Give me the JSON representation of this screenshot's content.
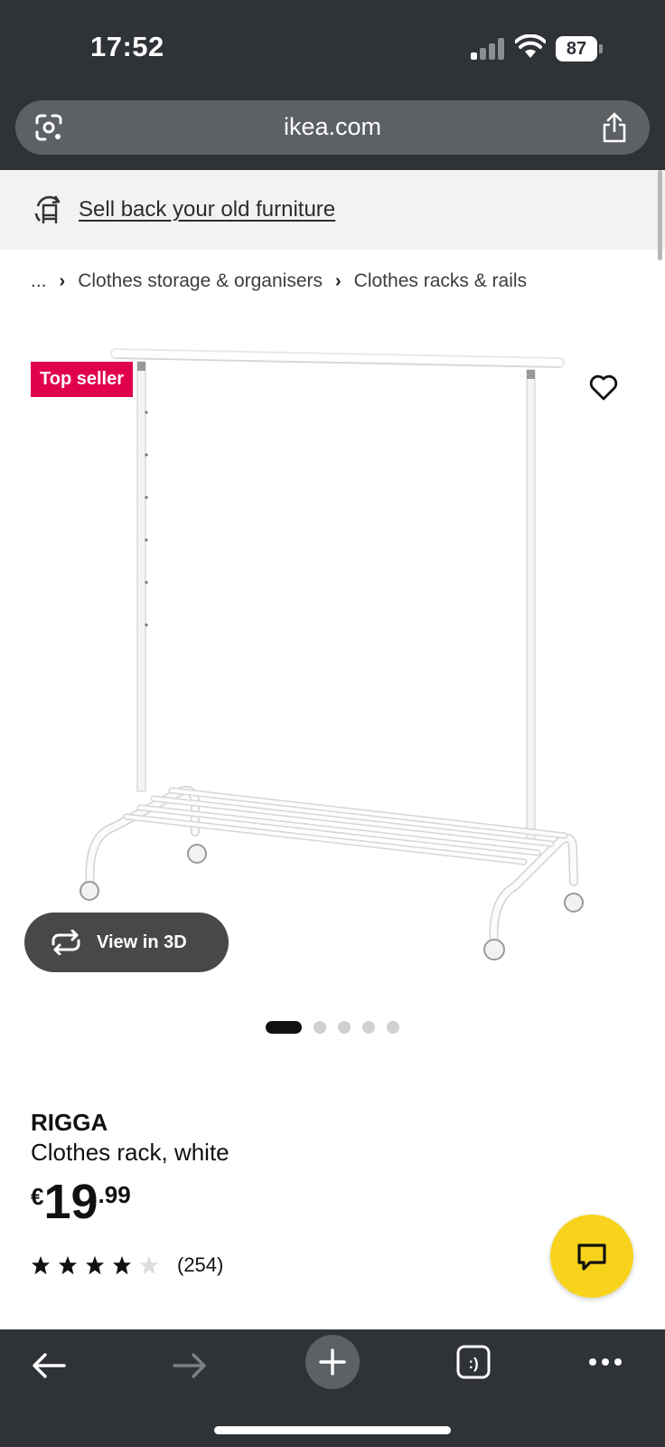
{
  "status_bar": {
    "time": "17:52",
    "battery": "87",
    "signal_bars_active": 1
  },
  "browser": {
    "url": "ikea.com",
    "icons": [
      "google-lens-icon",
      "share-icon"
    ]
  },
  "banner": {
    "icon": "buyback-recycle-icon",
    "link_text": "Sell back your old furniture"
  },
  "breadcrumb": {
    "items": [
      "...",
      "Clothes storage & organisers",
      "Clothes racks & rails"
    ]
  },
  "gallery": {
    "badge": "Top seller",
    "favorite_icon": "heart-icon",
    "view3d_label": "View in 3D",
    "image_count": 5,
    "active_index": 0
  },
  "product": {
    "name": "RIGGA",
    "description": "Clothes rack, white",
    "price_currency": "€",
    "price_integer": "19",
    "price_decimal": ".99",
    "rating_stars": 4,
    "rating_max": 5,
    "review_count": "(254)"
  },
  "chat": {
    "icon": "chat-bubble-icon",
    "color": "#f8d31c"
  },
  "toolbar": {
    "icons": [
      "back-arrow-icon",
      "forward-arrow-icon",
      "new-tab-plus-icon",
      "tabs-icon",
      "more-icon"
    ]
  },
  "colors": {
    "chrome": "#2f3236",
    "badge": "#e0004d",
    "view3d_button": "#484848"
  }
}
